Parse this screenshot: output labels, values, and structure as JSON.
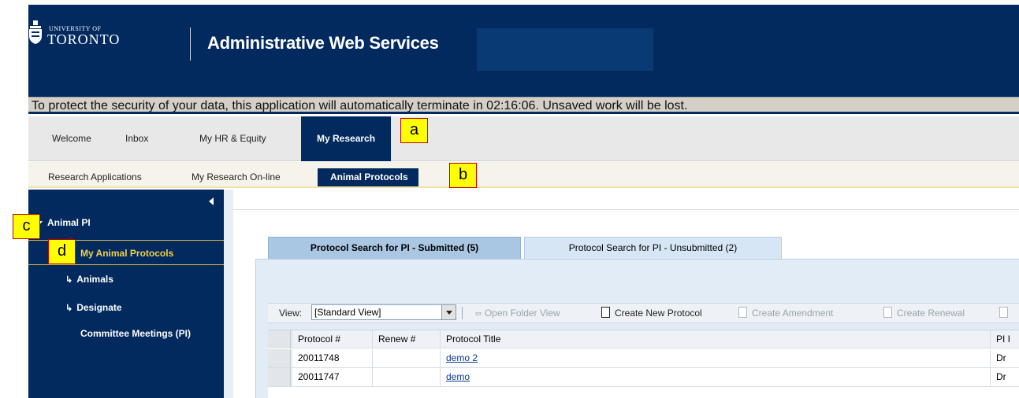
{
  "header": {
    "logo_small": "UNIVERSITY OF",
    "logo_big": "TORONTO",
    "app_title": "Administrative Web Services",
    "colors": {
      "header_bg": "#022a5e",
      "accent_yellow": "#f4d24a"
    }
  },
  "timeout_banner": "To protect the security of your data, this application will automatically terminate in 02:16:06. Unsaved work will be lost.",
  "nav1": {
    "items": [
      {
        "label": "Welcome"
      },
      {
        "label": "Inbox"
      },
      {
        "label": "My HR & Equity"
      },
      {
        "label": "My Research",
        "active": true
      }
    ]
  },
  "nav2": {
    "items": [
      {
        "label": "Research Applications"
      },
      {
        "label": "My Research On-line"
      },
      {
        "label": "Animal Protocols",
        "active": true
      }
    ]
  },
  "callouts": [
    "a",
    "b",
    "c",
    "d"
  ],
  "sidebar": {
    "group": "Animal PI",
    "items": [
      {
        "label": "My Animal Protocols",
        "selected": true
      },
      {
        "label": "Animals"
      },
      {
        "label": "Designate"
      },
      {
        "label": "Committee Meetings (PI)"
      }
    ]
  },
  "tabs": [
    {
      "label": "Protocol Search for PI - Submitted (5)",
      "active": true
    },
    {
      "label": "Protocol Search for PI - Unsubmitted (2)"
    }
  ],
  "toolbar": {
    "view_label": "View:",
    "view_value": "[Standard View]",
    "open_folder": "Open Folder View",
    "create_new": "Create New Protocol",
    "create_amendment": "Create Amendment",
    "create_renewal": "Create Renewal"
  },
  "table": {
    "columns": [
      "Protocol #",
      "Renew #",
      "Protocol Title",
      "PI I"
    ],
    "rows": [
      {
        "protocol": "20011748",
        "renew": "",
        "title": "demo 2",
        "pi": "Dr"
      },
      {
        "protocol": "20011747",
        "renew": "",
        "title": "demo",
        "pi": "Dr"
      }
    ]
  }
}
